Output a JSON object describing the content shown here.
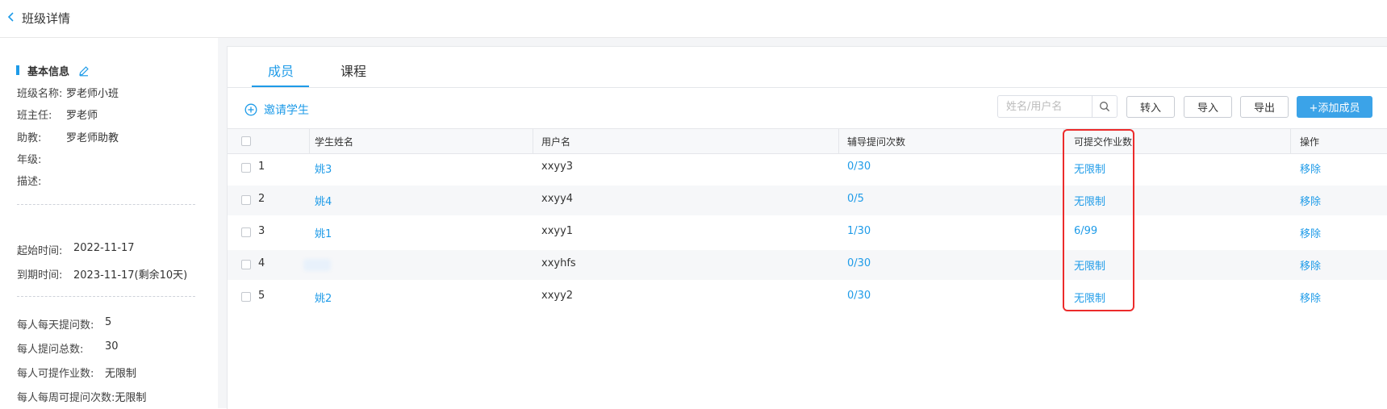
{
  "header": {
    "title": "班级详情"
  },
  "side": {
    "section_title": "基本信息",
    "info": [
      {
        "label": "班级名称:",
        "value": "罗老师小班"
      },
      {
        "label": "班主任:",
        "value": "罗老师"
      },
      {
        "label": "助教:",
        "value": "罗老师助教"
      },
      {
        "label": "年级:",
        "value": ""
      },
      {
        "label": "描述:",
        "value": ""
      }
    ],
    "dates": [
      {
        "label": "起始时间:",
        "value": "2022-11-17"
      },
      {
        "label": "到期时间:",
        "value": "2023-11-17(剩余10天)"
      }
    ],
    "limits": [
      {
        "label": "每人每天提问数:",
        "value": "5"
      },
      {
        "label": "每人提问总数:",
        "value": "30"
      },
      {
        "label": "每人可提作业数:",
        "value": "无限制"
      },
      {
        "label": "每人每周可提问次数:",
        "value": "无限制"
      }
    ]
  },
  "tabs": [
    "成员",
    "课程"
  ],
  "toolbar": {
    "invite_label": "邀请学生",
    "search_placeholder": "姓名/用户名",
    "transfer_in": "转入",
    "import": "导入",
    "export": "导出",
    "add_member": "+添加成员"
  },
  "table": {
    "columns": [
      "学生姓名",
      "用户名",
      "辅导提问次数",
      "可提交作业数",
      "操作"
    ],
    "rows": [
      {
        "index": "1",
        "name": "姚3",
        "username": "xxyy3",
        "questions": "0/30",
        "homework": "无限制",
        "action": "移除"
      },
      {
        "index": "2",
        "name": "姚4",
        "username": "xxyy4",
        "questions": "0/5",
        "homework": "无限制",
        "action": "移除"
      },
      {
        "index": "3",
        "name": "姚1",
        "username": "xxyy1",
        "questions": "1/30",
        "homework": "6/99",
        "action": "移除"
      },
      {
        "index": "4",
        "name": "",
        "username": "xxyhfs",
        "questions": "0/30",
        "homework": "无限制",
        "action": "移除"
      },
      {
        "index": "5",
        "name": "姚2",
        "username": "xxyy2",
        "questions": "0/30",
        "homework": "无限制",
        "action": "移除"
      }
    ]
  },
  "colors": {
    "accent": "#1e9be8",
    "highlight": "#ec2b2b",
    "primary_button": "#3ba3e8"
  }
}
